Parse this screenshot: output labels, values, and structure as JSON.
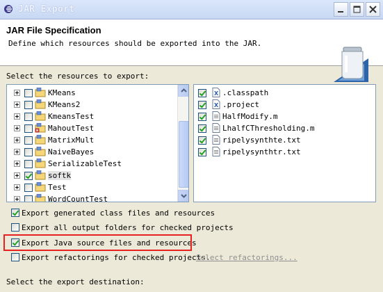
{
  "window": {
    "title": "JAR Export"
  },
  "header": {
    "title": "JAR File Specification",
    "description": "Define which resources should be exported into the JAR."
  },
  "resources": {
    "label": "Select the resources to export:",
    "projects": [
      {
        "name": "KMeans",
        "checked": false,
        "icon": "java-project-icon"
      },
      {
        "name": "KMeans2",
        "checked": false,
        "icon": "java-project-icon"
      },
      {
        "name": "KmeansTest",
        "checked": false,
        "icon": "java-project-icon"
      },
      {
        "name": "MahoutTest",
        "checked": false,
        "icon": "java-project-error-icon"
      },
      {
        "name": "MatrixMult",
        "checked": false,
        "icon": "java-project-icon"
      },
      {
        "name": "NaiveBayes",
        "checked": false,
        "icon": "java-project-icon"
      },
      {
        "name": "SerializableTest",
        "checked": false,
        "icon": "java-project-icon"
      },
      {
        "name": "softk",
        "checked": true,
        "icon": "java-project-icon"
      },
      {
        "name": "Test",
        "checked": false,
        "icon": "java-project-icon"
      },
      {
        "name": "WordCountTest",
        "checked": false,
        "icon": "java-project-icon"
      }
    ],
    "files": [
      {
        "name": ".classpath",
        "checked": true,
        "icon": "xml-file-icon"
      },
      {
        "name": ".project",
        "checked": true,
        "icon": "xml-file-icon"
      },
      {
        "name": "HalfModify.m",
        "checked": true,
        "icon": "text-file-icon"
      },
      {
        "name": "LhalfCThresholding.m",
        "checked": true,
        "icon": "text-file-icon"
      },
      {
        "name": "ripelysynthte.txt",
        "checked": true,
        "icon": "text-file-icon"
      },
      {
        "name": "ripelysynthtr.txt",
        "checked": true,
        "icon": "text-file-icon"
      }
    ]
  },
  "options": {
    "export_class_files": {
      "label": "Export generated class files and resources",
      "checked": true
    },
    "export_output_folders": {
      "label": "Export all output folders for checked projects",
      "checked": false
    },
    "export_java_source": {
      "label": "Export Java source files and resources",
      "checked": true
    },
    "export_refactorings": {
      "label": "Export refactorings for checked projects.",
      "checked": false
    },
    "select_refactorings_link": "Select refactorings..."
  },
  "destination": {
    "label": "Select the export destination:"
  },
  "colors": {
    "highlight_box": "#e82020",
    "title_bar": "#c8d8f3"
  }
}
